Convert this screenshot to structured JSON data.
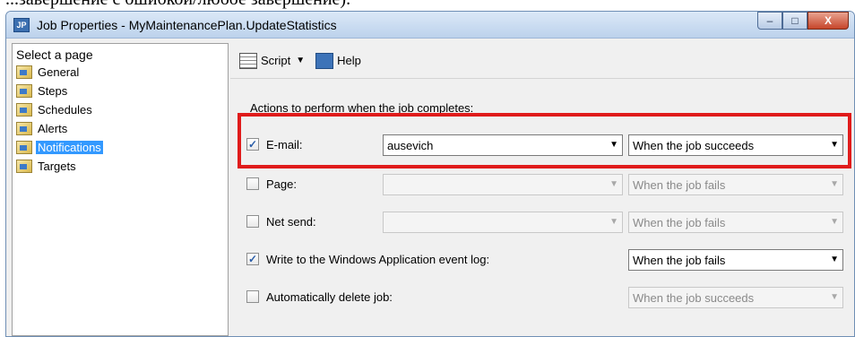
{
  "doc_fragment": "...завершение с ошибкой/любое завершение).",
  "window": {
    "title": "Job Properties - MyMaintenancePlan.UpdateStatistics",
    "app_icon_text": "JP",
    "minimize": "–",
    "maximize": "□",
    "close": "X"
  },
  "left": {
    "header": "Select a page",
    "items": [
      {
        "label": "General"
      },
      {
        "label": "Steps"
      },
      {
        "label": "Schedules"
      },
      {
        "label": "Alerts"
      },
      {
        "label": "Notifications",
        "selected": true
      },
      {
        "label": "Targets"
      }
    ]
  },
  "toolbar": {
    "script": "Script",
    "script_arrow": "▼",
    "help": "Help"
  },
  "actions": {
    "heading": "Actions to perform when the job completes:",
    "email": {
      "label": "E-mail:",
      "checked": true,
      "operator": "ausevich",
      "when": "When the job succeeds"
    },
    "page": {
      "label": "Page:",
      "checked": false,
      "operator": "",
      "when": "When the job fails"
    },
    "net_send": {
      "label": "Net send:",
      "checked": false,
      "operator": "",
      "when": "When the job fails"
    },
    "event_log": {
      "label": "Write to the Windows Application event log:",
      "checked": true,
      "when": "When the job fails"
    },
    "delete_job": {
      "label": "Automatically delete job:",
      "checked": false,
      "when": "When the job succeeds"
    }
  },
  "check_mark": "✓",
  "dropdown_arrow": "▼",
  "colors": {
    "highlight": "#e01b1b",
    "selection": "#3399ff"
  }
}
